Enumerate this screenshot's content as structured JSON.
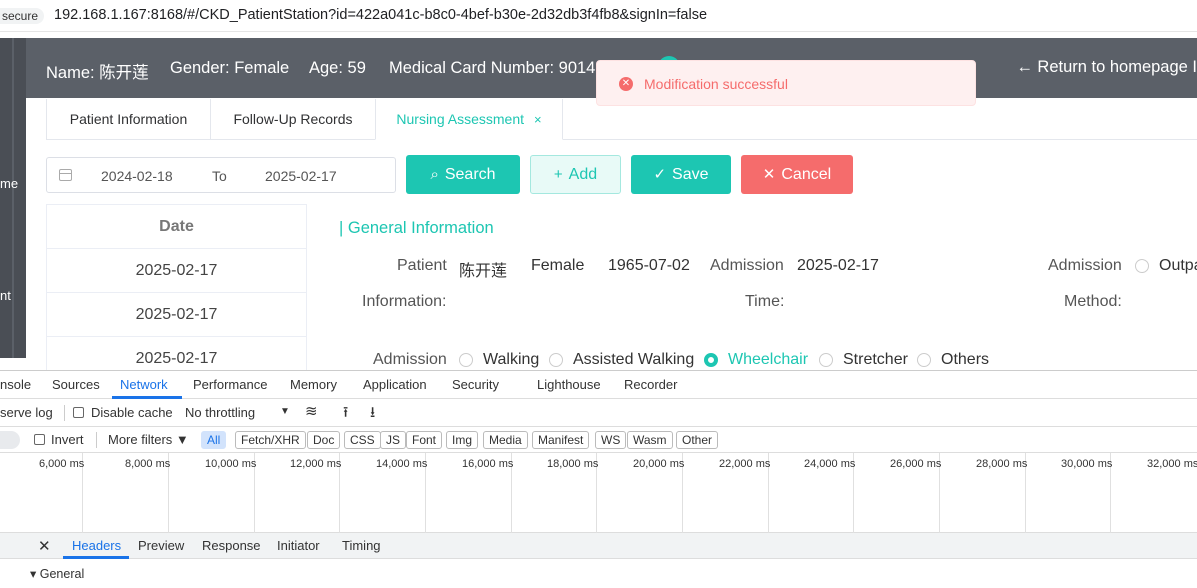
{
  "browser": {
    "insecure_label": "secure",
    "url": "192.168.1.167:8168/#/CKD_PatientStation?id=422a041c-b8c0-4bef-b30e-2d32db3f4fb8&signIn=false"
  },
  "leftnav": {
    "frag1": "me",
    "frag2": "nt"
  },
  "header": {
    "name": "Name: 陈开莲",
    "gender": "Gender: Female",
    "age": "Age: 59",
    "card": "Medical Card Number: 90140",
    "return": "← Return to homepage  I"
  },
  "toast": {
    "icon": "✕",
    "message": "Modification successful"
  },
  "tabs": [
    {
      "label": "Patient Information"
    },
    {
      "label": "Follow-Up Records"
    },
    {
      "label": "Nursing Assessment",
      "close": "×"
    }
  ],
  "filter": {
    "start": "2024-02-18",
    "to": "To",
    "end": "2025-02-17"
  },
  "buttons": {
    "search": "Search",
    "search_icon": "⌕",
    "add": "Add",
    "add_icon": "+",
    "save": "Save",
    "save_icon": "✓",
    "cancel": "Cancel",
    "cancel_icon": "✕"
  },
  "date_list": {
    "header": "Date",
    "rows": [
      "2025-02-17",
      "2025-02-17",
      "2025-02-17"
    ]
  },
  "general": {
    "title": "| General Information",
    "patient_label": "Patient",
    "information_label": "Information:",
    "patient_name": "陈开莲",
    "patient_gender": "Female",
    "patient_dob": "1965-07-02",
    "admission_label": "Admission",
    "time_label": "Time:",
    "admission_date": "2025-02-17",
    "admission2_label": "Admission",
    "method_label": "Method:",
    "method_option": "Outpa",
    "mode_label": "Admission",
    "modes": [
      "Walking",
      "Assisted Walking",
      "Wheelchair",
      "Stretcher",
      "Others"
    ],
    "selected_mode": "Wheelchair"
  },
  "devtools": {
    "tabs": [
      "nsole",
      "Sources",
      "Network",
      "Performance",
      "Memory",
      "Application",
      "Security",
      "Lighthouse",
      "Recorder"
    ],
    "active_tab": "Network",
    "toolbar": {
      "preserve_log": "serve log",
      "disable_cache": "Disable cache",
      "throttle": "No throttling",
      "throttle_caret": "▼"
    },
    "filter": {
      "invert": "Invert",
      "more_filters": "More filters ▼",
      "chips": [
        "All",
        "Fetch/XHR",
        "Doc",
        "CSS",
        "JS",
        "Font",
        "Img",
        "Media",
        "Manifest",
        "WS",
        "Wasm",
        "Other"
      ]
    },
    "ticks": [
      "6,000 ms",
      "8,000 ms",
      "10,000 ms",
      "12,000 ms",
      "14,000 ms",
      "16,000 ms",
      "18,000 ms",
      "20,000 ms",
      "22,000 ms",
      "24,000 ms",
      "26,000 ms",
      "28,000 ms",
      "30,000 ms",
      "32,000 ms"
    ],
    "detail_tabs": [
      "Headers",
      "Preview",
      "Response",
      "Initiator",
      "Timing"
    ],
    "close_icon": "✕",
    "general": "▾ General"
  }
}
